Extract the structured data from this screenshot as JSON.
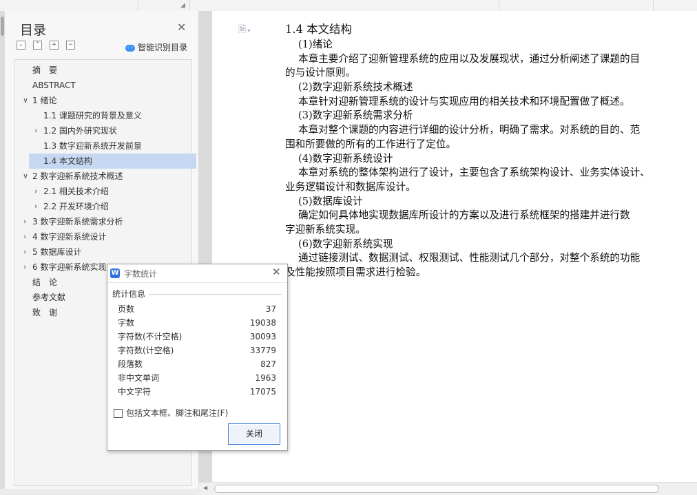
{
  "nav": {
    "title": "目录",
    "smart_label": "智能识别目录",
    "items": [
      {
        "label": "摘　要"
      },
      {
        "label": "ABSTRACT"
      },
      {
        "label": "1 绪论"
      },
      {
        "label": "1.1 课题研究的背景及意义"
      },
      {
        "label": "1.2 国内外研究现状"
      },
      {
        "label": "1.3 数字迎新系统开发前景"
      },
      {
        "label": "1.4 本文结构"
      },
      {
        "label": "2 数字迎新系统技术概述"
      },
      {
        "label": "2.1 相关技术介绍"
      },
      {
        "label": "2.2 开发环境介绍"
      },
      {
        "label": "3 数字迎新系统需求分析"
      },
      {
        "label": "4 数字迎新系统设计"
      },
      {
        "label": "5 数据库设计"
      },
      {
        "label": "6 数字迎新系统实现"
      },
      {
        "label": "结　论"
      },
      {
        "label": "参考文献"
      },
      {
        "label": "致　谢"
      }
    ]
  },
  "doc": {
    "heading": "1.4 本文结构",
    "lines": [
      "(1)绪论",
      "本章主要介绍了迎新管理系统的应用以及发展现状，通过分析阐述了课题的目",
      "的与设计原则。",
      "(2)数字迎新系统技术概述",
      "本章针对迎新管理系统的设计与实现应用的相关技术和环境配置做了概述。",
      "(3)数字迎新系统需求分析",
      "本章对整个课题的内容进行详细的设计分析，明确了需求。对系统的目的、范",
      "围和所要做的所有的工作进行了定位。",
      "(4)数字迎新系统设计",
      "本章对系统的整体架构进行了设计，主要包含了系统架构设计、业务实体设计、",
      "业务逻辑设计和数据库设计。",
      "(5)数据库设计",
      "确定如何具体地实现数据库所设计的方案以及进行系统框架的搭建并进行数",
      "字迎新系统实现。",
      "(6)数字迎新系统实现",
      "通过链接测试、数据测试、权限测试、性能测试几个部分，对整个系统的功能",
      "及性能按照项目需求进行检验。"
    ]
  },
  "dialog": {
    "title": "字数统计",
    "group_label": "统计信息",
    "stats": [
      {
        "label": "页数",
        "value": "37"
      },
      {
        "label": "字数",
        "value": "19038"
      },
      {
        "label": "字符数(不计空格)",
        "value": "30093"
      },
      {
        "label": "字符数(计空格)",
        "value": "33779"
      },
      {
        "label": "段落数",
        "value": "827"
      },
      {
        "label": "非中文单词",
        "value": "1963"
      },
      {
        "label": "中文字符",
        "value": "17075"
      }
    ],
    "checkbox_label": "包括文本框、脚注和尾注(F)",
    "close_button": "关闭"
  },
  "colors": {
    "selected_item": "#c6d7f2",
    "accent": "#3a78d8"
  }
}
